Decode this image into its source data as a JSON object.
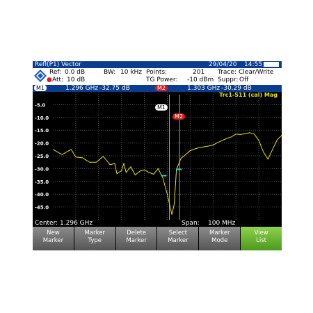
{
  "title": "Refl(P1) Vector",
  "date": "29/04/20",
  "time": "14:55",
  "settings": {
    "ref_label": "Ref:",
    "ref_value": "0.0 dB",
    "att_label": "Att:",
    "att_value": "10 dB",
    "bw_label": "BW:",
    "bw_value": "10 kHz",
    "points_label": "Points:",
    "points_value": "201",
    "tg_label": "TG Power:",
    "tg_value": "-10 dBm",
    "trace_label": "Trace:",
    "trace_value": "Clear/Write",
    "suppr_label": "Suppr:",
    "suppr_value": "Off"
  },
  "markers": [
    {
      "label": "M1",
      "freq": "1.296 GHz",
      "level": "-32.75 dB",
      "color": "#ffffff"
    },
    {
      "label": "M2",
      "freq": "1.303 GHz",
      "level": "-30.29 dB",
      "color": "#d81e1e"
    }
  ],
  "trace_label": "Trc1-S11 (cal) Mag",
  "y_ticks": [
    "-5.0",
    "-10.0",
    "-15.0",
    "-20.0",
    "-25.0",
    "-30.0",
    "-35.0",
    "-40.0",
    "-45.0"
  ],
  "center": "Center: 1.296 GHz",
  "span_label": "Span:",
  "span_value": "100 MHz",
  "softkeys": [
    {
      "line1": "New",
      "line2": "Marker"
    },
    {
      "line1": "Marker",
      "line2": "Type"
    },
    {
      "line1": "Delete",
      "line2": "Marker"
    },
    {
      "line1": "Select",
      "line2": "Marker"
    },
    {
      "line1": "Marker",
      "line2": "Mode"
    },
    {
      "line1": "View",
      "line2": "List"
    }
  ],
  "chart_data": {
    "type": "line",
    "ylim": [
      -50,
      0
    ],
    "x_label_note": "",
    "series": [
      {
        "color": "#e6e600",
        "x": [
          0,
          4,
          8,
          10,
          13,
          16,
          19,
          22,
          25,
          27,
          28,
          30,
          31,
          32,
          34,
          36,
          38,
          40,
          42,
          44,
          46,
          48,
          50,
          52,
          53,
          54,
          56,
          58,
          60,
          62,
          64,
          66,
          68,
          70,
          72,
          74,
          76,
          78,
          80,
          82,
          84,
          86,
          88,
          90,
          92,
          94,
          96,
          98,
          100
        ],
        "y": [
          -22.5,
          -24.5,
          -22.5,
          -25.5,
          -25.8,
          -27.5,
          -27.5,
          -25.2,
          -28.5,
          -28,
          -32,
          -30.8,
          -28,
          -31.5,
          -29.3,
          -32.5,
          -31,
          -30.5,
          -31.5,
          -32.2,
          -30,
          -33.5,
          -40,
          -48,
          -44,
          -30.3,
          -26,
          -24.5,
          -23,
          -22.3,
          -21.8,
          -21.5,
          -21.2,
          -20.8,
          -19.8,
          -19,
          -18.2,
          -17.6,
          -16.5,
          -16.7,
          -16.3,
          -16,
          -16.5,
          -19,
          -23.5,
          -26.3,
          -22.5,
          -18.8,
          -17
        ]
      }
    ]
  }
}
